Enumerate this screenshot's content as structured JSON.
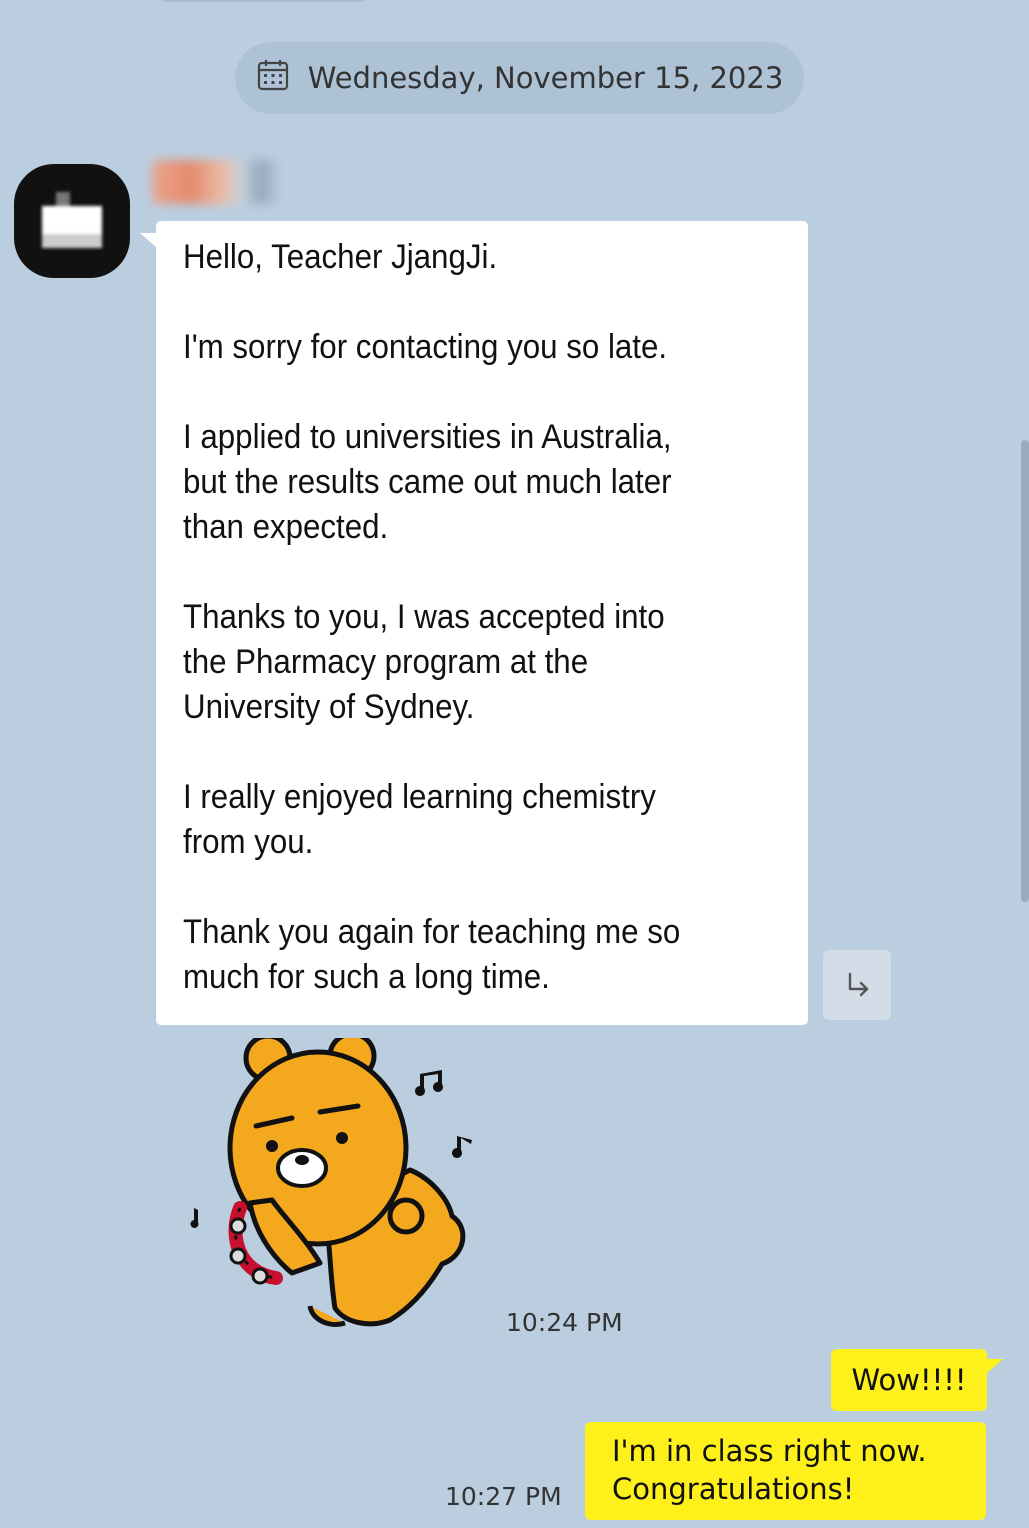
{
  "date_divider": {
    "text": "Wednesday, November 15, 2023",
    "icon": "calendar-icon"
  },
  "incoming": {
    "paragraphs": [
      [
        "Hello, Teacher JjangJi."
      ],
      [
        "I'm sorry for contacting you so late."
      ],
      [
        "I applied to universities in Australia,",
        "but the results came out much later",
        "than expected."
      ],
      [
        "Thanks to you, I was accepted into",
        "the Pharmacy program at the",
        "University of Sydney."
      ],
      [
        "I really enjoyed learning chemistry",
        "from you."
      ],
      [
        "Thank you again for teaching me so",
        "much for such a long time."
      ]
    ],
    "time": "10:24 PM",
    "share_icon": "share-arrow-icon",
    "sticker": "bear-tambourine-sticker"
  },
  "outgoing": {
    "messages": [
      {
        "lines": [
          "Wow!!!!"
        ]
      },
      {
        "lines": [
          "I'm in class right now.",
          "Congratulations!"
        ]
      }
    ],
    "time": "10:27 PM"
  },
  "colors": {
    "background": "#bacee0",
    "incoming_bubble": "#ffffff",
    "outgoing_bubble": "#fef01b",
    "sticker_body": "#f4a81e"
  }
}
